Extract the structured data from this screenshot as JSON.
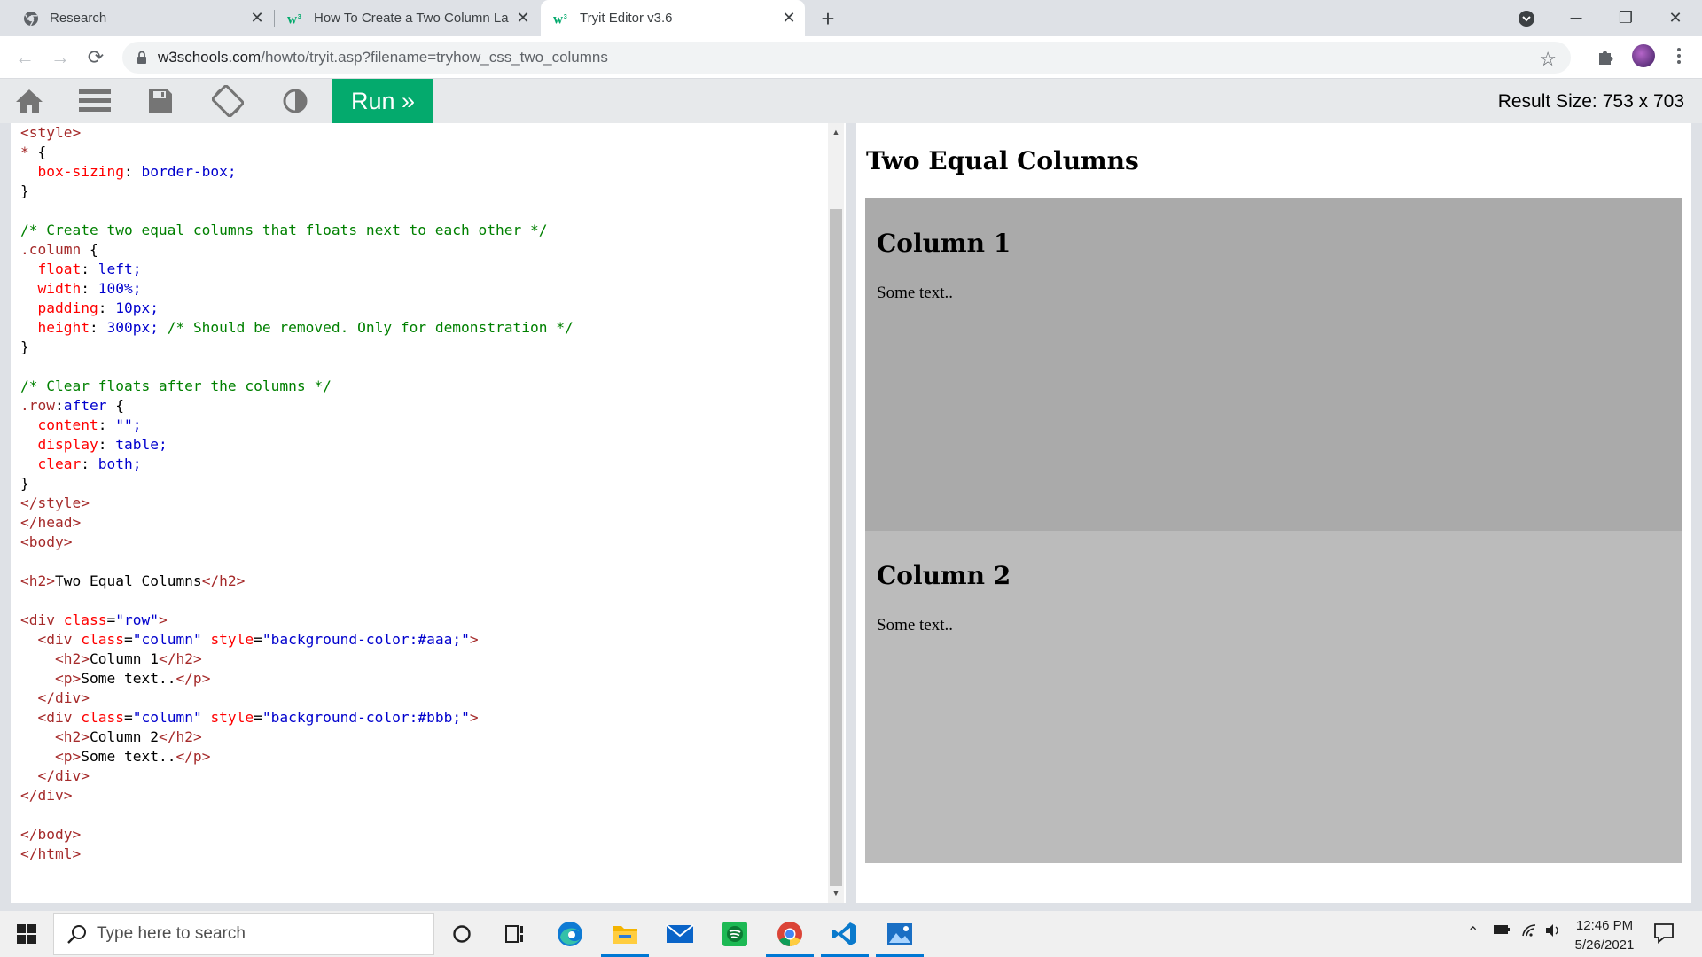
{
  "browser": {
    "tabs": [
      {
        "title": "Research",
        "favicon": "chrome-icon",
        "active": false
      },
      {
        "title": "How To Create a Two Column La",
        "favicon": "w3schools-icon",
        "active": false
      },
      {
        "title": "Tryit Editor v3.6",
        "favicon": "w3schools-icon",
        "active": true
      }
    ],
    "url_domain": "w3schools.com",
    "url_path": "/howto/tryit.asp?filename=tryhow_css_two_columns"
  },
  "tryit": {
    "run_label": "Run »",
    "result_size_label": "Result Size:",
    "result_size_value": "753 x 703",
    "icons": [
      "home-icon",
      "menu-icon",
      "save-icon",
      "rotate-icon",
      "theme-icon"
    ]
  },
  "editor": {
    "lines": [
      "<style>",
      "* {",
      "  box-sizing: border-box;",
      "}",
      "",
      "/* Create two equal columns that floats next to each other */",
      ".column {",
      "  float: left;",
      "  width: 100%;",
      "  padding: 10px;",
      "  height: 300px; /* Should be removed. Only for demonstration */",
      "}",
      "",
      "/* Clear floats after the columns */",
      ".row:after {",
      "  content: \"\";",
      "  display: table;",
      "  clear: both;",
      "}",
      "</style>",
      "</head>",
      "<body>",
      "",
      "<h2>Two Equal Columns</h2>",
      "",
      "<div class=\"row\">",
      "  <div class=\"column\" style=\"background-color:#aaa;\">",
      "    <h2>Column 1</h2>",
      "    <p>Some text..</p>",
      "  </div>",
      "  <div class=\"column\" style=\"background-color:#bbb;\">",
      "    <h2>Column 2</h2>",
      "    <p>Some text..</p>",
      "  </div>",
      "</div>",
      "",
      "</body>",
      "</html>"
    ]
  },
  "result": {
    "heading": "Two Equal Columns",
    "columns": [
      {
        "title": "Column 1",
        "text": "Some text..",
        "color": "#aaaaaa"
      },
      {
        "title": "Column 2",
        "text": "Some text..",
        "color": "#bbbbbb"
      }
    ]
  },
  "taskbar": {
    "search_placeholder": "Type here to search",
    "time": "12:46 PM",
    "date": "5/26/2021",
    "apps": [
      "cortana-icon",
      "task-view-icon",
      "edge-icon",
      "file-explorer-icon",
      "mail-icon",
      "spotify-icon",
      "chrome-icon",
      "vscode-icon",
      "photos-icon"
    ]
  },
  "colors": {
    "run_green": "#04aa6d",
    "tag_brown": "#a52a2a",
    "value_blue": "#0000cd",
    "comment_green": "#008000",
    "property_red": "#ff0000"
  }
}
